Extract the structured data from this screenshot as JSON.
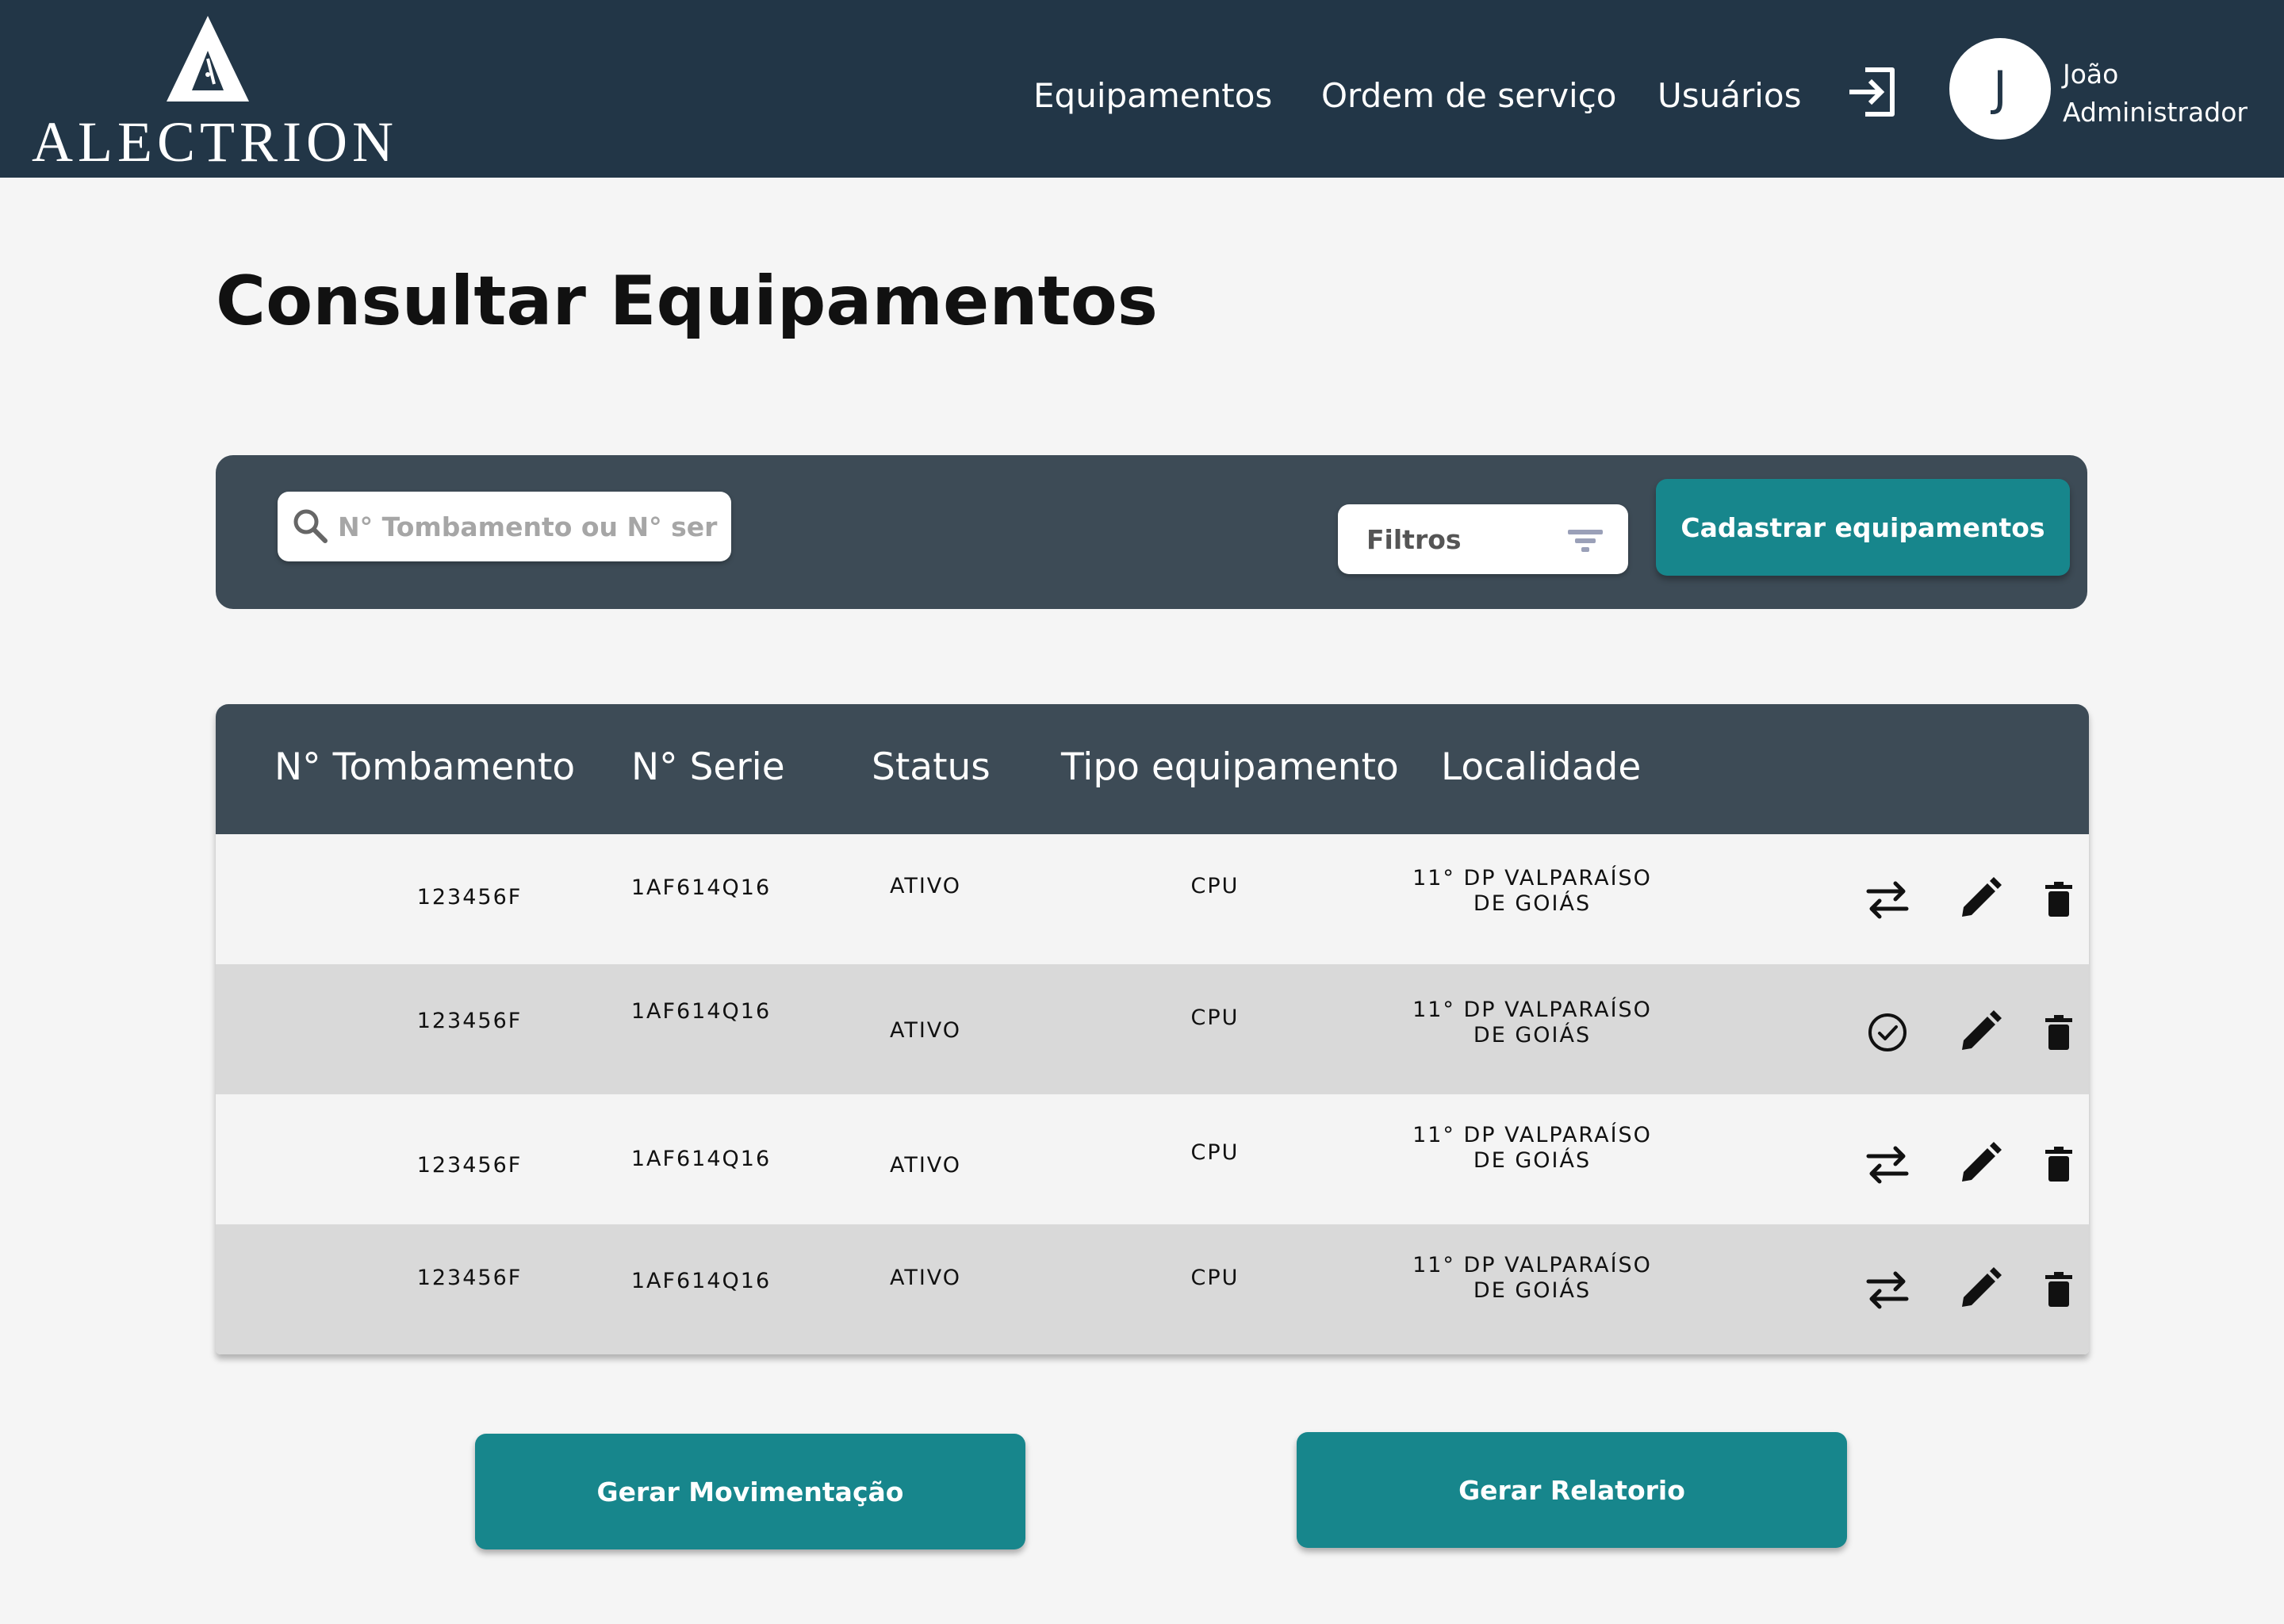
{
  "header": {
    "logo_text": "ALECTRION",
    "nav": {
      "equipamentos": "Equipamentos",
      "ordem_servico": "Ordem de serviço",
      "usuarios": "Usuários"
    },
    "user": {
      "initial": "J",
      "name": "João",
      "role": "Administrador"
    }
  },
  "page": {
    "title": "Consultar Equipamentos"
  },
  "toolbar": {
    "search_placeholder": "N° Tombamento ou N° serie",
    "search_value": "",
    "filter_label": "Filtros",
    "register_button": "Cadastrar equipamentos"
  },
  "table": {
    "headers": {
      "tombamento": "N° Tombamento",
      "serie": "N° Serie",
      "status": "Status",
      "tipo": "Tipo equipamento",
      "localidade": "Localidade"
    },
    "rows": [
      {
        "tombamento": "123456F",
        "serie": "1AF614Q16",
        "status": "ATIVO",
        "tipo": "CPU",
        "localidade_l1": "11° DP VALPARAÍSO",
        "localidade_l2": "DE GOIÁS",
        "action_icon": "swap-arrows-icon"
      },
      {
        "tombamento": "123456F",
        "serie": "1AF614Q16",
        "status": "ATIVO",
        "tipo": "CPU",
        "localidade_l1": "11° DP VALPARAÍSO",
        "localidade_l2": "DE GOIÁS",
        "action_icon": "check-circle-icon"
      },
      {
        "tombamento": "123456F",
        "serie": "1AF614Q16",
        "status": "ATIVO",
        "tipo": "CPU",
        "localidade_l1": "11° DP VALPARAÍSO",
        "localidade_l2": "DE GOIÁS",
        "action_icon": "swap-arrows-icon"
      },
      {
        "tombamento": "123456F",
        "serie": "1AF614Q16",
        "status": "ATIVO",
        "tipo": "CPU",
        "localidade_l1": "11° DP VALPARAÍSO",
        "localidade_l2": "DE GOIÁS",
        "action_icon": "swap-arrows-icon"
      }
    ]
  },
  "footer": {
    "movimentacao_button": "Gerar Movimentação",
    "relatorio_button": "Gerar Relatorio"
  },
  "colors": {
    "header_bg": "#223647",
    "panel_bg": "#3d4b56",
    "accent": "#17868c",
    "row_alt": "#d9d9d9",
    "row_normal": "#f4f4f4"
  }
}
